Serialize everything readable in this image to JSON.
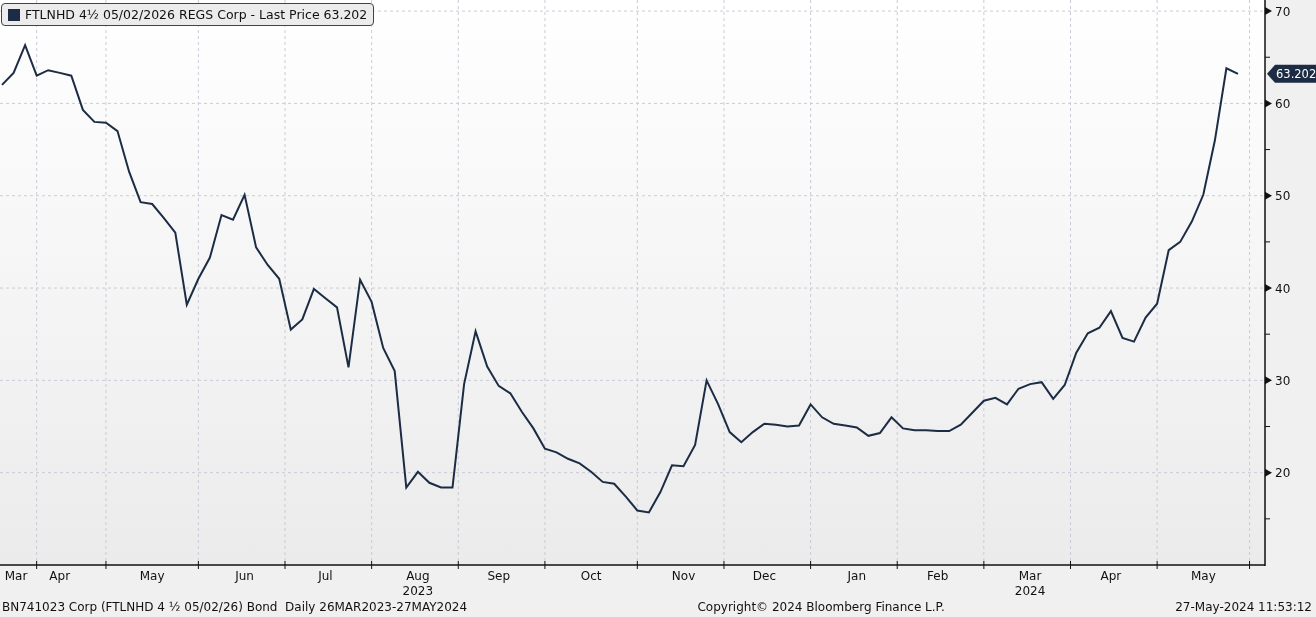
{
  "legend": {
    "label": "FTLNHD 4½ 05/02/2026 REGS Corp - Last Price 63.202",
    "color": "#1c2c44"
  },
  "price_tag": "63.202",
  "chart_data": {
    "type": "line",
    "grid": true,
    "ylim": [
      10,
      71.2
    ],
    "yticks": [
      20,
      30,
      40,
      50,
      60,
      70
    ],
    "categories": [
      null,
      "Mar",
      null,
      null,
      null,
      "Apr",
      null,
      null,
      null,
      null,
      null,
      null,
      null,
      "May",
      null,
      null,
      null,
      null,
      null,
      null,
      null,
      "Jun",
      null,
      null,
      null,
      null,
      null,
      null,
      "Jul",
      null,
      null,
      null,
      null,
      null,
      null,
      null,
      "Aug\n2023",
      null,
      null,
      null,
      null,
      null,
      null,
      "Sep",
      null,
      null,
      null,
      null,
      null,
      null,
      null,
      "Oct",
      null,
      null,
      null,
      null,
      null,
      null,
      null,
      "Nov",
      null,
      null,
      null,
      null,
      null,
      null,
      "Dec",
      null,
      null,
      null,
      null,
      null,
      null,
      null,
      "Jan",
      null,
      null,
      null,
      null,
      null,
      null,
      "Feb",
      null,
      null,
      null,
      null,
      null,
      null,
      null,
      "Mar\n2024",
      null,
      null,
      null,
      null,
      null,
      null,
      "Apr",
      null,
      null,
      null,
      null,
      null,
      null,
      null,
      "May",
      null,
      null,
      null
    ],
    "series": [
      {
        "color": "#1c2c44",
        "values": [
          62,
          63.3,
          66.3,
          63,
          63.6,
          63.3,
          63,
          59.3,
          58,
          57.9,
          57,
          52.6,
          49.3,
          49.1,
          47.6,
          46,
          38.2,
          41,
          43.3,
          47.9,
          47.4,
          50.1,
          44.4,
          42.5,
          41,
          35.5,
          36.6,
          39.9,
          38.9,
          37.9,
          31.4,
          40.9,
          38.5,
          33.5,
          31,
          18.4,
          20.1,
          18.9,
          18.4,
          18.4,
          29.6,
          35.3,
          31.5,
          29.4,
          28.6,
          26.6,
          24.8,
          22.6,
          22.2,
          21.5,
          21,
          20.1,
          19,
          18.8,
          17.4,
          15.9,
          15.7,
          17.9,
          20.8,
          20.7,
          23,
          30,
          27.4,
          24.4,
          23.3,
          24.4,
          25.3,
          25.2,
          25,
          25.1,
          27.4,
          26,
          25.3,
          25.1,
          24.9,
          24,
          24.3,
          26,
          24.8,
          24.6,
          24.6,
          24.5,
          24.5,
          25.2,
          26.5,
          27.8,
          28.1,
          27.4,
          29.1,
          29.6,
          29.8,
          28,
          29.5,
          33,
          35.1,
          35.7,
          37.5,
          34.6,
          34.2,
          36.8,
          38.3,
          44.1,
          45,
          47.2,
          50.1,
          56,
          63.8,
          63.2
        ]
      }
    ]
  },
  "footer": {
    "left": "BN741023 Corp (FTLNHD 4 ½ 05/02/26) Bond  Daily 26MAR2023-27MAY2024",
    "center": "Copyright© 2024 Bloomberg Finance L.P.",
    "right": "27-May-2024 11:53:12"
  }
}
